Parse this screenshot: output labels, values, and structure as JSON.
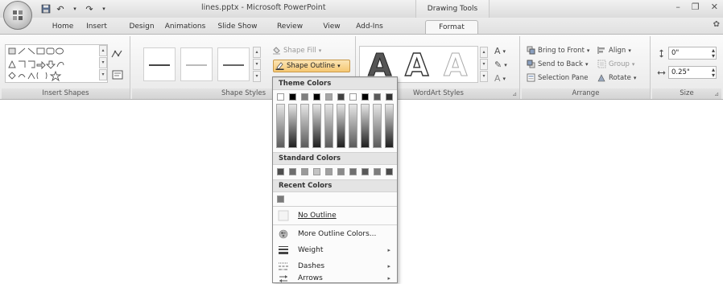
{
  "titlebar": {
    "title": "lines.pptx - Microsoft PowerPoint",
    "contextual_tab_title": "Drawing Tools"
  },
  "tabs": [
    "Home",
    "Insert",
    "Design",
    "Animations",
    "Slide Show",
    "Review",
    "View",
    "Add-Ins",
    "Format"
  ],
  "active_tab": "Format",
  "ribbon": {
    "groups": {
      "insert_shapes": "Insert Shapes",
      "shape_styles": "Shape Styles",
      "wordart_styles": "WordArt Styles",
      "arrange": "Arrange",
      "size": "Size"
    },
    "shape_fill": "Shape Fill",
    "shape_outline": "Shape Outline",
    "bring_to_front": "Bring to Front",
    "send_to_back": "Send to Back",
    "selection_pane": "Selection Pane",
    "align": "Align",
    "group": "Group",
    "rotate": "Rotate",
    "height_value": "0\"",
    "width_value": "0.25\"",
    "wordart_letter": "A"
  },
  "dropdown": {
    "theme_colors_header": "Theme Colors",
    "standard_colors_header": "Standard Colors",
    "recent_colors_header": "Recent Colors",
    "items": [
      {
        "label": "No Outline",
        "icon": "no-outline-box-icon",
        "submenu": false
      },
      {
        "label": "More Outline Colors...",
        "icon": "color-wheel-icon",
        "submenu": false
      },
      {
        "label": "Weight",
        "icon": "line-weight-icon",
        "submenu": true
      },
      {
        "label": "Dashes",
        "icon": "dash-style-icon",
        "submenu": true
      },
      {
        "label": "Arrows",
        "icon": "arrows-icon",
        "submenu": true
      }
    ],
    "theme_top_row": [
      "#ffffff",
      "#000000",
      "#7f7f7f",
      "#000000",
      "#a5a5a5",
      "#404040",
      "#ffffff",
      "#000000",
      "#595959",
      "#333333"
    ],
    "standard_colors": [
      "#4d4d4d",
      "#6e6e6e",
      "#9a9a9a",
      "#c4c4c4",
      "#a0a0a0",
      "#8a8a8a",
      "#6f6f6f",
      "#595959",
      "#7d7d7d",
      "#4a4a4a"
    ],
    "recent_colors": [
      "#7a7a7a"
    ]
  }
}
